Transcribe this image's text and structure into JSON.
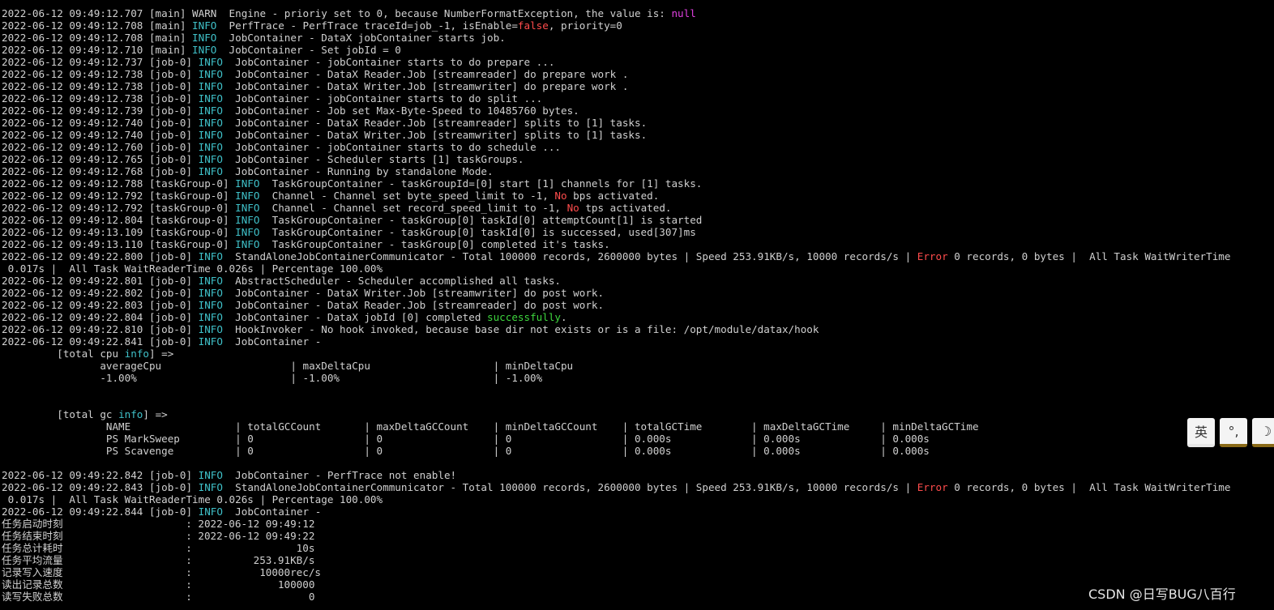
{
  "terminal": {
    "lines": [
      [
        {
          "t": "2022-06-12 09:49:12.707 [main] WARN  Engine - prioriy set to 0, because NumberFormatException, the value is: "
        },
        {
          "t": "null",
          "c": "pink"
        }
      ],
      [
        {
          "t": "2022-06-12 09:49:12.708 [main] "
        },
        {
          "t": "INFO",
          "c": "info"
        },
        {
          "t": "  PerfTrace - PerfTrace traceId=job_-1, isEnable="
        },
        {
          "t": "false",
          "c": "red"
        },
        {
          "t": ", priority=0"
        }
      ],
      [
        {
          "t": "2022-06-12 09:49:12.708 [main] "
        },
        {
          "t": "INFO",
          "c": "info"
        },
        {
          "t": "  JobContainer - DataX jobContainer starts job."
        }
      ],
      [
        {
          "t": "2022-06-12 09:49:12.710 [main] "
        },
        {
          "t": "INFO",
          "c": "info"
        },
        {
          "t": "  JobContainer - Set jobId = 0"
        }
      ],
      [
        {
          "t": "2022-06-12 09:49:12.737 [job-0] "
        },
        {
          "t": "INFO",
          "c": "info"
        },
        {
          "t": "  JobContainer - jobContainer starts to do prepare ..."
        }
      ],
      [
        {
          "t": "2022-06-12 09:49:12.738 [job-0] "
        },
        {
          "t": "INFO",
          "c": "info"
        },
        {
          "t": "  JobContainer - DataX Reader.Job [streamreader] do prepare work ."
        }
      ],
      [
        {
          "t": "2022-06-12 09:49:12.738 [job-0] "
        },
        {
          "t": "INFO",
          "c": "info"
        },
        {
          "t": "  JobContainer - DataX Writer.Job [streamwriter] do prepare work ."
        }
      ],
      [
        {
          "t": "2022-06-12 09:49:12.738 [job-0] "
        },
        {
          "t": "INFO",
          "c": "info"
        },
        {
          "t": "  JobContainer - jobContainer starts to do split ..."
        }
      ],
      [
        {
          "t": "2022-06-12 09:49:12.739 [job-0] "
        },
        {
          "t": "INFO",
          "c": "info"
        },
        {
          "t": "  JobContainer - Job set Max-Byte-Speed to 10485760 bytes."
        }
      ],
      [
        {
          "t": "2022-06-12 09:49:12.740 [job-0] "
        },
        {
          "t": "INFO",
          "c": "info"
        },
        {
          "t": "  JobContainer - DataX Reader.Job [streamreader] splits to [1] tasks."
        }
      ],
      [
        {
          "t": "2022-06-12 09:49:12.740 [job-0] "
        },
        {
          "t": "INFO",
          "c": "info"
        },
        {
          "t": "  JobContainer - DataX Writer.Job [streamwriter] splits to [1] tasks."
        }
      ],
      [
        {
          "t": "2022-06-12 09:49:12.760 [job-0] "
        },
        {
          "t": "INFO",
          "c": "info"
        },
        {
          "t": "  JobContainer - jobContainer starts to do schedule ..."
        }
      ],
      [
        {
          "t": "2022-06-12 09:49:12.765 [job-0] "
        },
        {
          "t": "INFO",
          "c": "info"
        },
        {
          "t": "  JobContainer - Scheduler starts [1] taskGroups."
        }
      ],
      [
        {
          "t": "2022-06-12 09:49:12.768 [job-0] "
        },
        {
          "t": "INFO",
          "c": "info"
        },
        {
          "t": "  JobContainer - Running by standalone Mode."
        }
      ],
      [
        {
          "t": "2022-06-12 09:49:12.788 [taskGroup-0] "
        },
        {
          "t": "INFO",
          "c": "info"
        },
        {
          "t": "  TaskGroupContainer - taskGroupId=[0] start [1] channels for [1] tasks."
        }
      ],
      [
        {
          "t": "2022-06-12 09:49:12.792 [taskGroup-0] "
        },
        {
          "t": "INFO",
          "c": "info"
        },
        {
          "t": "  Channel - Channel set byte_speed_limit to -1, "
        },
        {
          "t": "No",
          "c": "red"
        },
        {
          "t": " bps activated."
        }
      ],
      [
        {
          "t": "2022-06-12 09:49:12.792 [taskGroup-0] "
        },
        {
          "t": "INFO",
          "c": "info"
        },
        {
          "t": "  Channel - Channel set record_speed_limit to -1, "
        },
        {
          "t": "No",
          "c": "red"
        },
        {
          "t": " tps activated."
        }
      ],
      [
        {
          "t": "2022-06-12 09:49:12.804 [taskGroup-0] "
        },
        {
          "t": "INFO",
          "c": "info"
        },
        {
          "t": "  TaskGroupContainer - taskGroup[0] taskId[0] attemptCount[1] is started"
        }
      ],
      [
        {
          "t": "2022-06-12 09:49:13.109 [taskGroup-0] "
        },
        {
          "t": "INFO",
          "c": "info"
        },
        {
          "t": "  TaskGroupContainer - taskGroup[0] taskId[0] is successed, used[307]ms"
        }
      ],
      [
        {
          "t": "2022-06-12 09:49:13.110 [taskGroup-0] "
        },
        {
          "t": "INFO",
          "c": "info"
        },
        {
          "t": "  TaskGroupContainer - taskGroup[0] completed it's tasks."
        }
      ],
      [
        {
          "t": "2022-06-12 09:49:22.800 [job-0] "
        },
        {
          "t": "INFO",
          "c": "info"
        },
        {
          "t": "  StandAloneJobContainerCommunicator - Total 100000 records, 2600000 bytes | Speed 253.91KB/s, 10000 records/s | "
        },
        {
          "t": "Error",
          "c": "red"
        },
        {
          "t": " 0 records, 0 bytes |  All Task WaitWriterTime"
        }
      ],
      [
        {
          "t": " 0.017s |  All Task WaitReaderTime 0.026s | Percentage 100.00%"
        }
      ],
      [
        {
          "t": "2022-06-12 09:49:22.801 [job-0] "
        },
        {
          "t": "INFO",
          "c": "info"
        },
        {
          "t": "  AbstractScheduler - Scheduler accomplished all tasks."
        }
      ],
      [
        {
          "t": "2022-06-12 09:49:22.802 [job-0] "
        },
        {
          "t": "INFO",
          "c": "info"
        },
        {
          "t": "  JobContainer - DataX Writer.Job [streamwriter] do post work."
        }
      ],
      [
        {
          "t": "2022-06-12 09:49:22.803 [job-0] "
        },
        {
          "t": "INFO",
          "c": "info"
        },
        {
          "t": "  JobContainer - DataX Reader.Job [streamreader] do post work."
        }
      ],
      [
        {
          "t": "2022-06-12 09:49:22.804 [job-0] "
        },
        {
          "t": "INFO",
          "c": "info"
        },
        {
          "t": "  JobContainer - DataX jobId [0] completed "
        },
        {
          "t": "successfully",
          "c": "green"
        },
        {
          "t": "."
        }
      ],
      [
        {
          "t": "2022-06-12 09:49:22.810 [job-0] "
        },
        {
          "t": "INFO",
          "c": "info"
        },
        {
          "t": "  HookInvoker - No hook invoked, because base dir not exists or is a file: /opt/module/datax/hook"
        }
      ],
      [
        {
          "t": "2022-06-12 09:49:22.841 [job-0] "
        },
        {
          "t": "INFO",
          "c": "info"
        },
        {
          "t": "  JobContainer -"
        }
      ],
      [
        {
          "t": "         [total cpu "
        },
        {
          "t": "info",
          "c": "info"
        },
        {
          "t": "] =>"
        }
      ],
      [
        {
          "t": "                averageCpu                     | maxDeltaCpu                    | minDeltaCpu"
        }
      ],
      [
        {
          "t": "                -1.00%                         | -1.00%                         | -1.00%"
        }
      ],
      [
        {
          "t": ""
        }
      ],
      [
        {
          "t": ""
        }
      ],
      [
        {
          "t": "         [total gc "
        },
        {
          "t": "info",
          "c": "info"
        },
        {
          "t": "] =>"
        }
      ],
      [
        {
          "t": "                 NAME                 | totalGCCount       | maxDeltaGCCount    | minDeltaGCCount    | totalGCTime        | maxDeltaGCTime     | minDeltaGCTime"
        }
      ],
      [
        {
          "t": "                 PS MarkSweep         | 0                  | 0                  | 0                  | 0.000s             | 0.000s             | 0.000s"
        }
      ],
      [
        {
          "t": "                 PS Scavenge          | 0                  | 0                  | 0                  | 0.000s             | 0.000s             | 0.000s"
        }
      ],
      [
        {
          "t": ""
        }
      ],
      [
        {
          "t": "2022-06-12 09:49:22.842 [job-0] "
        },
        {
          "t": "INFO",
          "c": "info"
        },
        {
          "t": "  JobContainer - PerfTrace not enable!"
        }
      ],
      [
        {
          "t": "2022-06-12 09:49:22.843 [job-0] "
        },
        {
          "t": "INFO",
          "c": "info"
        },
        {
          "t": "  StandAloneJobContainerCommunicator - Total 100000 records, 2600000 bytes | Speed 253.91KB/s, 10000 records/s | "
        },
        {
          "t": "Error",
          "c": "red"
        },
        {
          "t": " 0 records, 0 bytes |  All Task WaitWriterTime"
        }
      ],
      [
        {
          "t": " 0.017s |  All Task WaitReaderTime 0.026s | Percentage 100.00%"
        }
      ],
      [
        {
          "t": "2022-06-12 09:49:22.844 [job-0] "
        },
        {
          "t": "INFO",
          "c": "info"
        },
        {
          "t": "  JobContainer -"
        }
      ],
      [
        {
          "t": "任务启动时刻                    : 2022-06-12 09:49:12"
        }
      ],
      [
        {
          "t": "任务结束时刻                    : 2022-06-12 09:49:22"
        }
      ],
      [
        {
          "t": "任务总计耗时                    :                 10s"
        }
      ],
      [
        {
          "t": "任务平均流量                    :          253.91KB/s"
        }
      ],
      [
        {
          "t": "记录写入速度                    :           10000rec/s"
        }
      ],
      [
        {
          "t": "读出记录总数                    :              100000"
        }
      ],
      [
        {
          "t": "读写失败总数                    :                   0"
        }
      ]
    ]
  },
  "ime_toolbar": {
    "lang_label": "英",
    "punct_label": "°,",
    "mode_label": "☽"
  },
  "watermark": {
    "text": "CSDN @日写BUG八百行"
  }
}
